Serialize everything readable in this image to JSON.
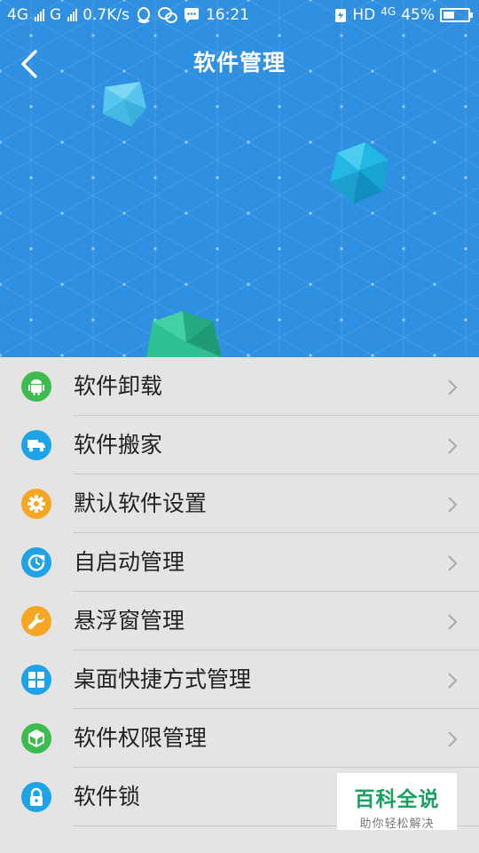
{
  "status_bar": {
    "sim1": "4G",
    "sim2": "G",
    "speed": "0.7K/s",
    "time": "16:21",
    "hd": "HD",
    "network": "4G",
    "battery": "45%",
    "battery_level": 0.45
  },
  "header": {
    "title": "软件管理"
  },
  "menu": {
    "items": [
      {
        "label": "软件卸载",
        "icon": "android-icon",
        "color": "#3dbb4f"
      },
      {
        "label": "软件搬家",
        "icon": "truck-icon",
        "color": "#1ea3e8"
      },
      {
        "label": "默认软件设置",
        "icon": "gear-icon",
        "color": "#f5a623"
      },
      {
        "label": "自启动管理",
        "icon": "power-clock-icon",
        "color": "#1ea3e8"
      },
      {
        "label": "悬浮窗管理",
        "icon": "wrench-icon",
        "color": "#f5a623"
      },
      {
        "label": "桌面快捷方式管理",
        "icon": "grid-icon",
        "color": "#1ea3e8"
      },
      {
        "label": "软件权限管理",
        "icon": "cube-icon",
        "color": "#3dbb4f"
      },
      {
        "label": "软件锁",
        "icon": "lock-icon",
        "color": "#1ea3e8"
      }
    ]
  },
  "watermark": {
    "title": "百科全说",
    "subtitle": "助你轻松解决"
  }
}
